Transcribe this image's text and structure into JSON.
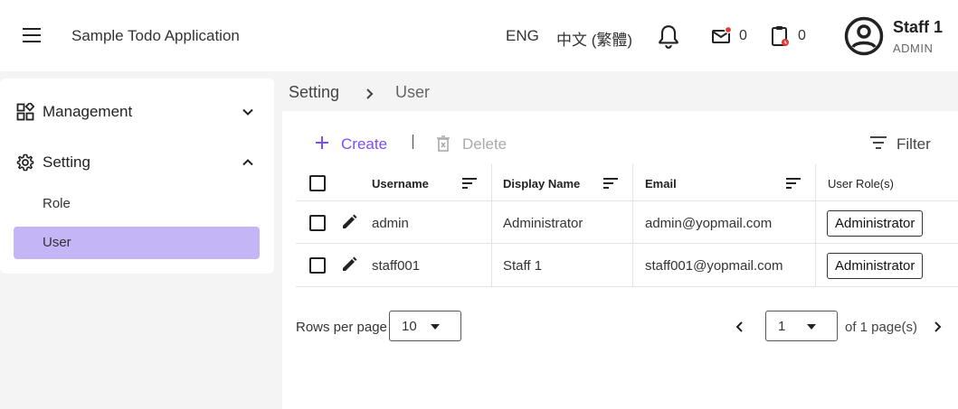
{
  "header": {
    "app_title": "Sample Todo Application",
    "lang_en": "ENG",
    "lang_zh": "中文 (繁體)",
    "mail_count": "0",
    "task_count": "0",
    "user_name": "Staff 1",
    "user_role": "ADMIN",
    "icons": [
      "menu-icon",
      "bell-icon",
      "mail-icon",
      "clipboard-icon",
      "account-circle-icon"
    ]
  },
  "sidebar": {
    "groups": [
      {
        "label": "Management",
        "icon": "widgets-icon",
        "expanded": false
      },
      {
        "label": "Setting",
        "icon": "gear-icon",
        "expanded": true
      }
    ],
    "sub_items": [
      {
        "label": "Role",
        "active": false
      },
      {
        "label": "User",
        "active": true
      }
    ]
  },
  "breadcrumb": {
    "parent": "Setting",
    "current": "User"
  },
  "toolbar": {
    "create_label": "Create",
    "delete_label": "Delete",
    "filter_label": "Filter"
  },
  "table": {
    "columns": [
      "Username",
      "Display Name",
      "Email",
      "User Role(s)"
    ],
    "rows": [
      {
        "username": "admin",
        "display_name": "Administrator",
        "email": "admin@yopmail.com",
        "role": "Administrator"
      },
      {
        "username": "staff001",
        "display_name": "Staff 1",
        "email": "staff001@yopmail.com",
        "role": "Administrator"
      }
    ]
  },
  "pagination": {
    "rows_per_page_label": "Rows per page",
    "rows_per_page_value": "10",
    "page_value": "1",
    "pages_text": "of 1 page(s)"
  },
  "colors": {
    "accent": "#7c4dff",
    "active_nav_bg": "#c4b5f7",
    "notification_dot": "#e53935"
  }
}
